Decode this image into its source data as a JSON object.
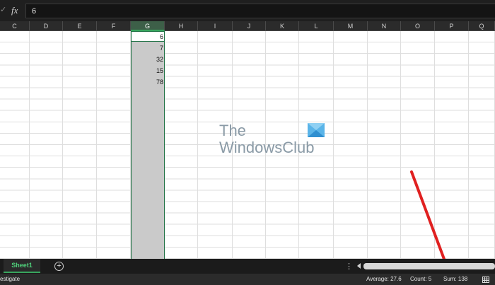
{
  "formula_bar": {
    "value": "6"
  },
  "columns": [
    {
      "label": "C",
      "selected": false
    },
    {
      "label": "D",
      "selected": false
    },
    {
      "label": "E",
      "selected": false
    },
    {
      "label": "F",
      "selected": false
    },
    {
      "label": "G",
      "selected": true
    },
    {
      "label": "H",
      "selected": false
    },
    {
      "label": "I",
      "selected": false
    },
    {
      "label": "J",
      "selected": false
    },
    {
      "label": "K",
      "selected": false
    },
    {
      "label": "L",
      "selected": false
    },
    {
      "label": "M",
      "selected": false
    },
    {
      "label": "N",
      "selected": false
    },
    {
      "label": "O",
      "selected": false
    },
    {
      "label": "P",
      "selected": false
    },
    {
      "label": "Q",
      "selected": false
    }
  ],
  "cells": [
    "6",
    "7",
    "32",
    "15",
    "78"
  ],
  "watermark": {
    "line1": "The",
    "line2": "WindowsClub"
  },
  "sheet_tabs": [
    "Sheet1"
  ],
  "status": {
    "mode": "estigate",
    "average": "Average: 27.6",
    "count": "Count: 5",
    "sum": "Sum: 138"
  },
  "colors": {
    "accent": "#217346",
    "arrow": "#e02020",
    "selection": "#cacaca"
  }
}
